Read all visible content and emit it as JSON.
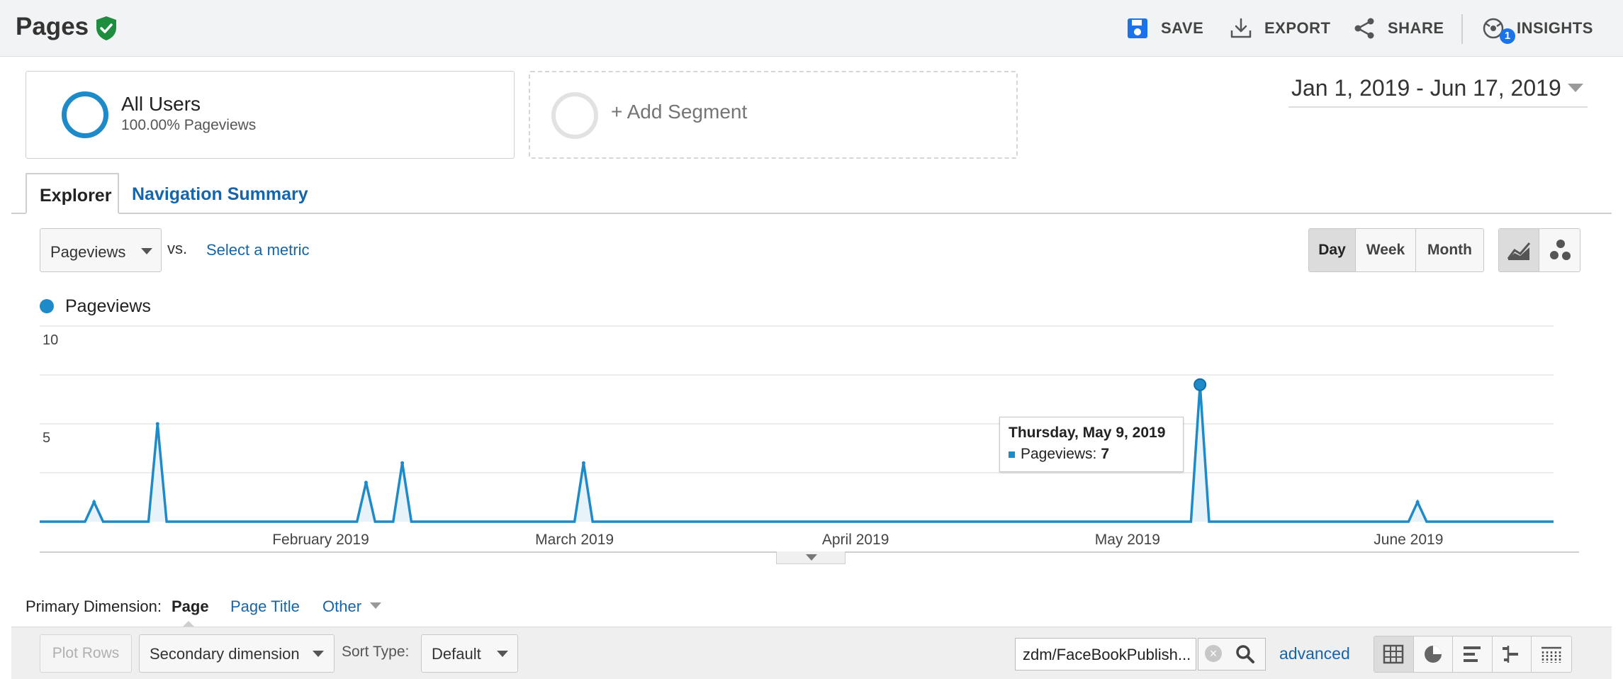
{
  "header": {
    "title": "Pages",
    "save_label": "SAVE",
    "export_label": "EXPORT",
    "share_label": "SHARE",
    "insights_label": "INSIGHTS",
    "insights_badge": "1",
    "verified_color": "#1e8e3e",
    "accent_color": "#1a73e8"
  },
  "segments": {
    "active": {
      "name": "All Users",
      "detail": "100.00% Pageviews",
      "color": "#1f8ac8"
    },
    "add_label": "+ Add Segment"
  },
  "date_range": "Jan 1, 2019 - Jun 17, 2019",
  "tabs": [
    {
      "label": "Explorer",
      "active": true
    },
    {
      "label": "Navigation Summary",
      "active": false
    }
  ],
  "metric": {
    "selected": "Pageviews",
    "vs_label": "vs.",
    "select_metric_label": "Select a metric"
  },
  "granularity": [
    {
      "label": "Day",
      "active": true
    },
    {
      "label": "Week",
      "active": false
    },
    {
      "label": "Month",
      "active": false
    }
  ],
  "view_toggles": [
    {
      "icon": "line-chart-icon",
      "active": true
    },
    {
      "icon": "motion-chart-icon",
      "active": false
    }
  ],
  "chart_data": {
    "type": "line",
    "series": [
      {
        "name": "Pageviews",
        "color": "#1f8ac8",
        "points": [
          [
            "2019-01-07",
            1
          ],
          [
            "2019-01-14",
            5
          ],
          [
            "2019-02-06",
            2
          ],
          [
            "2019-02-10",
            3
          ],
          [
            "2019-03-02",
            3
          ],
          [
            "2019-05-09",
            7
          ],
          [
            "2019-06-02",
            1
          ]
        ]
      }
    ],
    "x_range": [
      "2019-01-01",
      "2019-06-17"
    ],
    "x_ticks": [
      "February 2019",
      "March 2019",
      "April 2019",
      "May 2019",
      "June 2019"
    ],
    "y_ticks": [
      "10",
      "5"
    ],
    "ylim": [
      0,
      10
    ],
    "grid": true,
    "legend": "top-left",
    "tooltip": {
      "title": "Thursday, May 9, 2019",
      "label": "Pageviews:",
      "value": "7"
    }
  },
  "primary_dimension": {
    "label": "Primary Dimension:",
    "active": "Page",
    "options": [
      "Page Title",
      "Other"
    ]
  },
  "table_toolbar": {
    "plot_rows_label": "Plot Rows",
    "secondary_dimension_label": "Secondary dimension",
    "sort_type_label": "Sort Type:",
    "sort_type_value": "Default",
    "search_value": "zdm/FaceBookPublish...",
    "advanced_label": "advanced",
    "view_icons": [
      "table-view-icon",
      "pie-view-icon",
      "performance-view-icon",
      "comparison-view-icon",
      "pivot-view-icon"
    ]
  }
}
